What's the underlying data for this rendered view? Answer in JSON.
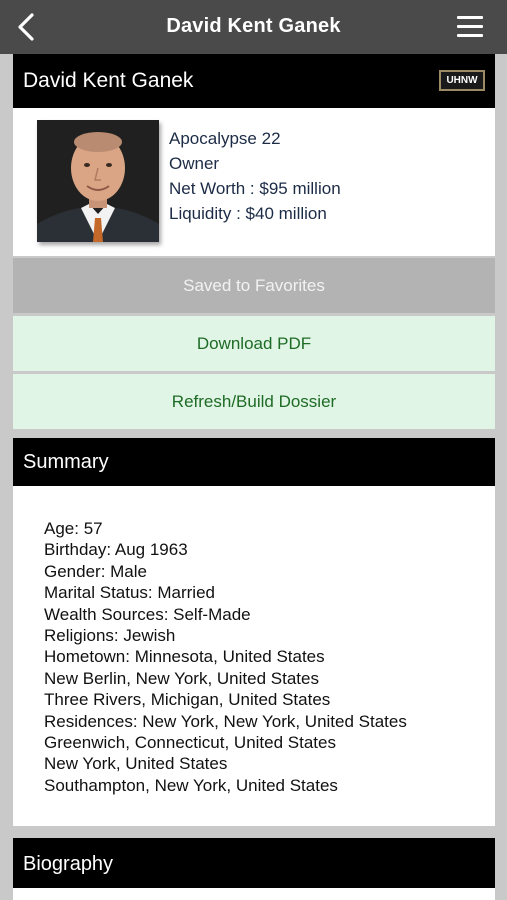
{
  "topbar": {
    "title": "David Kent Ganek",
    "back_icon": "chevron-left-icon",
    "menu_icon": "hamburger-menu-icon"
  },
  "profile": {
    "name": "David Kent Ganek",
    "badge": "UHNW",
    "company": "Apocalypse 22",
    "role": "Owner",
    "net_worth": "Net Worth : $95 million",
    "liquidity": "Liquidity : $40 million"
  },
  "actions": {
    "favorites": "Saved to Favorites",
    "download_pdf": "Download PDF",
    "refresh": "Refresh/Build Dossier"
  },
  "summary": {
    "title": "Summary",
    "lines": [
      "Age: 57",
      "Birthday: Aug 1963",
      "Gender: Male",
      "Marital Status: Married",
      "Wealth Sources: Self-Made",
      "Religions: Jewish",
      "Hometown: Minnesota, United States",
      "New Berlin, New York, United States",
      "Three Rivers, Michigan, United States",
      "Residences: New York, New York, United States",
      "Greenwich, Connecticut, United States",
      "New York, United States",
      "Southampton, New York, United States"
    ]
  },
  "biography": {
    "title": "Biography"
  },
  "colors": {
    "topbar": "#4a4a4a",
    "header": "#000000",
    "favorites_bg": "#b3b3b3",
    "action_bg": "#e1f5e6",
    "action_text": "#1e6b25",
    "info_text": "#1c2b46"
  }
}
